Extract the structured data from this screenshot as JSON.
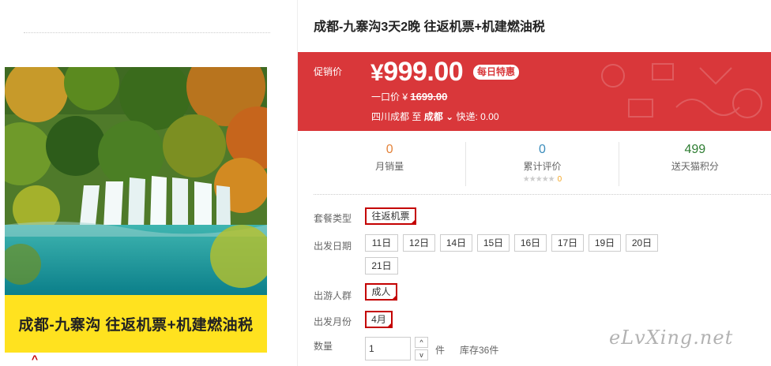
{
  "product": {
    "title": "成都-九寨沟3天2晚 往返机票+机建燃油税",
    "image_caption": "成都-九寨沟 往返机票+机建燃油税"
  },
  "promo": {
    "label": "促销价",
    "currency": "¥",
    "price": "999.00",
    "badge": "每日特惠",
    "orig_label": "一口价 ¥",
    "orig_price": "1699.00",
    "ship_from": "四川成都",
    "ship_to_word": "至",
    "ship_to": "成都",
    "ship_fee_label": "快递:",
    "ship_fee": "0.00",
    "color": "#d9373a"
  },
  "stats": [
    {
      "num": "0",
      "label": "月销量",
      "color": "#e4833a"
    },
    {
      "num": "0",
      "label": "累计评价",
      "color": "#3c8dbc",
      "stars": "★★★★★",
      "review_count": "0"
    },
    {
      "num": "499",
      "label": "送天猫积分",
      "color": "#2e7d32"
    }
  ],
  "options": {
    "package_label": "套餐类型",
    "package_values": [
      "往返机票"
    ],
    "date_label": "出发日期",
    "dates": [
      "11日",
      "12日",
      "14日",
      "15日",
      "16日",
      "17日",
      "19日",
      "20日",
      "21日"
    ],
    "crowd_label": "出游人群",
    "crowd_values": [
      "成人"
    ],
    "month_label": "出发月份",
    "month_values": [
      "4月"
    ]
  },
  "quantity": {
    "label": "数量",
    "value": "1",
    "unit": "件",
    "stock": "库存36件",
    "up_icon": "^",
    "down_icon": "v"
  },
  "watermark": "eLvXing.net",
  "scroll_up_icon": "^"
}
